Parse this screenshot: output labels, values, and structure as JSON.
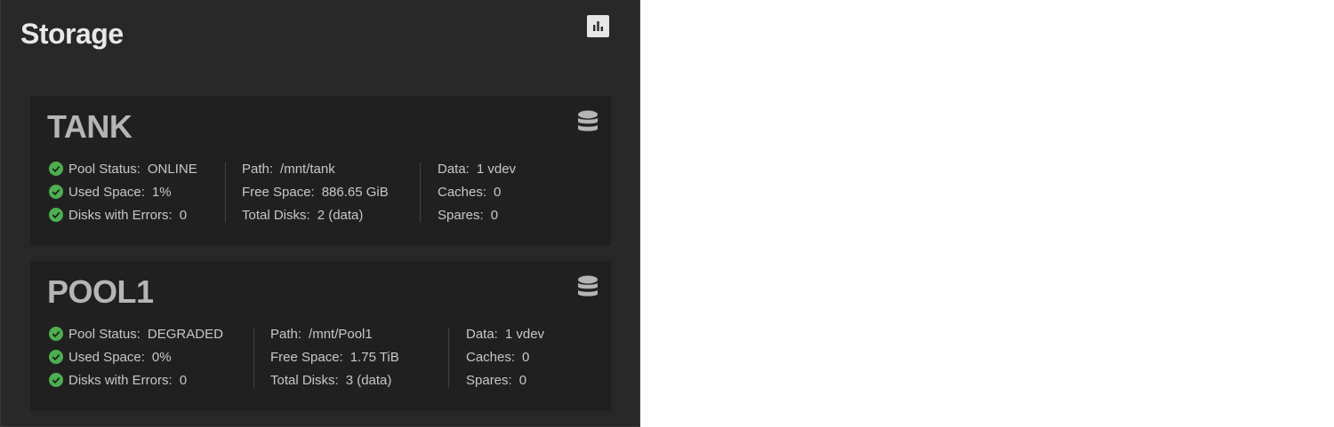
{
  "widget": {
    "title": "Storage"
  },
  "icons": {
    "chart": "bar-chart-icon",
    "pool": "database-icon",
    "status_ok": "check-circle-icon"
  },
  "colors": {
    "background": "#282828",
    "card": "#202020",
    "ok": "#4caf50",
    "text": "#c8c8c8",
    "pool_name": "#b5b5b5"
  },
  "pools": [
    {
      "name": "TANK",
      "status_label": "Pool Status:",
      "status_value": "ONLINE",
      "used_label": "Used Space:",
      "used_value": "1%",
      "errors_label": "Disks with Errors:",
      "errors_value": "0",
      "path_label": "Path:",
      "path_value": "/mnt/tank",
      "free_label": "Free Space:",
      "free_value": "886.65 GiB",
      "total_label": "Total Disks:",
      "total_value": "2 (data)",
      "data_label": "Data:",
      "data_value": "1 vdev",
      "caches_label": "Caches:",
      "caches_value": "0",
      "spares_label": "Spares:",
      "spares_value": "0"
    },
    {
      "name": "POOL1",
      "status_label": "Pool Status:",
      "status_value": "DEGRADED",
      "used_label": "Used Space:",
      "used_value": "0%",
      "errors_label": "Disks with Errors:",
      "errors_value": "0",
      "path_label": "Path:",
      "path_value": "/mnt/Pool1",
      "free_label": "Free Space:",
      "free_value": "1.75 TiB",
      "total_label": "Total Disks:",
      "total_value": "3 (data)",
      "data_label": "Data:",
      "data_value": "1 vdev",
      "caches_label": "Caches:",
      "caches_value": "0",
      "spares_label": "Spares:",
      "spares_value": "0"
    }
  ]
}
